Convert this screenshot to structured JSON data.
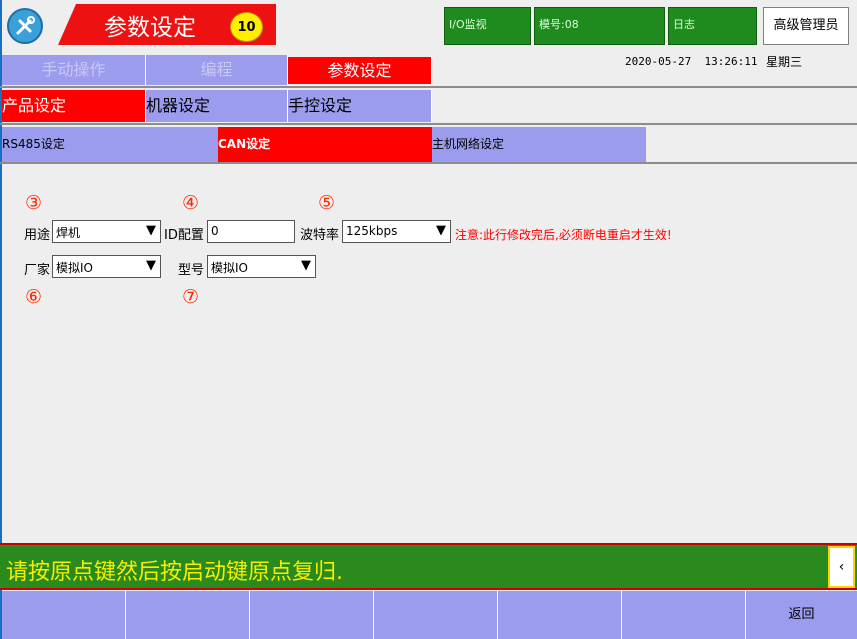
{
  "header": {
    "logo_icon": "tools-icon",
    "title": "参数设定",
    "badge": "10",
    "io_monitor": "I/O监视",
    "mold_no": "模号:08",
    "log": "日志",
    "admin": "高级管理员",
    "date": "2020-05-27",
    "time": "13:26:11",
    "weekday": "星期三"
  },
  "main_tabs": [
    {
      "label": "手动操作",
      "active": false
    },
    {
      "label": "编程",
      "active": false
    },
    {
      "label": "参数设定",
      "active": true
    }
  ],
  "sub_tabs": [
    {
      "label": "产品设定",
      "active": true
    },
    {
      "label": "机器设定",
      "active": false
    },
    {
      "label": "手控设定",
      "active": false
    }
  ],
  "comm_tabs": [
    {
      "label": "RS485设定",
      "active": false
    },
    {
      "label": "CAN设定",
      "active": true
    },
    {
      "label": "主机网络设定",
      "active": false
    }
  ],
  "form": {
    "markers": [
      "③",
      "④",
      "⑤",
      "⑥",
      "⑦"
    ],
    "usage_label": "用途",
    "usage_value": "焊机",
    "id_label": "ID配置",
    "id_value": "0",
    "baud_label": "波特率",
    "baud_value": "125kbps",
    "notice": "注意:此行修改完后,必须断电重启才生效!",
    "vendor_label": "厂家",
    "vendor_value": "模拟IO",
    "model_label": "型号",
    "model_value": "模拟IO",
    "dropdown_glyph": "▼"
  },
  "status": {
    "message": "请按原点键然后按启动键原点复归.",
    "scroll_glyph": "‹"
  },
  "footer": {
    "keys": [
      "",
      "",
      "",
      "",
      "",
      "",
      "返回"
    ]
  },
  "colors": {
    "active_tab": "#ff0000",
    "inactive_tab": "#9c9cee",
    "status_bg": "#2a8a1d",
    "status_text": "#f4ee00"
  }
}
